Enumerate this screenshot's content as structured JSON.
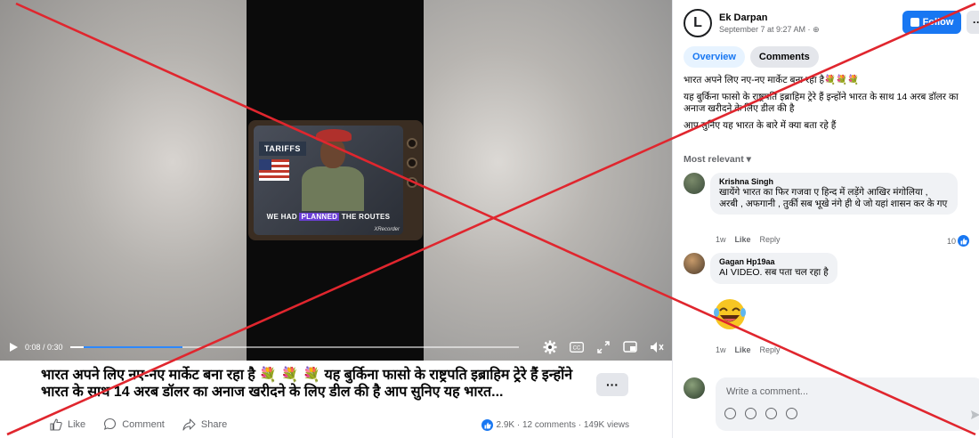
{
  "video": {
    "tv_label_tariffs": "TARIFFS",
    "tv_caption_pre": "WE HAD ",
    "tv_caption_highlight": "PLANNED",
    "tv_caption_post": " THE ROUTES",
    "watermark": "XRecorder",
    "time": "0:08 / 0:30",
    "progress": 0.03,
    "buffered": 0.25
  },
  "post": {
    "title": "भारत अपने लिए नए-नए मार्केट बना रहा है 💐 💐 💐  यह बुर्किना फासो के राष्ट्रपति इब्राहिम ट्रेरे हैं इन्होंने भारत के साथ 14 अरब डॉलर का अनाज खरीदने के लिए डील की है आप सुनिए यह भारत...",
    "more_label": "···",
    "actions": {
      "like": "Like",
      "comment": "Comment",
      "share": "Share"
    },
    "stats": "2.9K · 12 comments · 149K views"
  },
  "side": {
    "author": "Ek Darpan",
    "avatar_letter": "L",
    "time": "September 7 at 9:27 AM · ",
    "follow": "Follow",
    "more": "···",
    "tabs": [
      "Overview",
      "Comments"
    ],
    "desc": [
      "भारत अपने लिए नए-नए मार्केट बना रहा है💐💐💐",
      "यह बुर्किना फासो के राष्ट्रपति इब्राहिम ट्रेरे हैं इन्होंने भारत के साथ 14 अरब डॉलर का अनाज खरीदने के लिए डील की है",
      "आप सुनिए यह भारत के बारे में क्या बता रहे हैं"
    ],
    "most_relevant": "Most relevant ▾",
    "comments": [
      {
        "name": "Krishna Singh",
        "text": "खायेंगे भारत का फिर गजवा ए हिन्द में लड़ेंगे आखिर मंगोलिया , अरबी , अफगानी , तुर्की सब भूखे नंगे ही थे जो यहां शासन कर के गए",
        "time": "1w",
        "like": "Like",
        "reply": "Reply",
        "reactions": "10"
      },
      {
        "name": "Gagan Hp19aa",
        "text": "AI VIDEO. सब पता चल रहा है",
        "time": "1w",
        "like": "Like",
        "reply": "Reply"
      }
    ],
    "write_placeholder": "Write a comment..."
  },
  "colors": {
    "accent": "#1877f2",
    "cross": "#e0262e"
  }
}
